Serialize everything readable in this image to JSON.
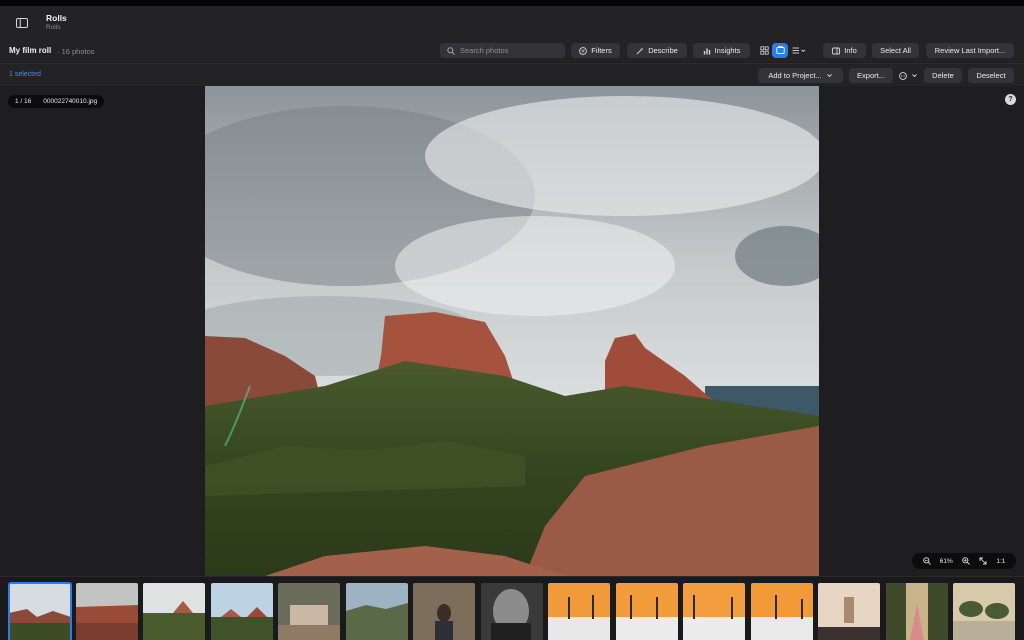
{
  "window": {
    "title": "Rolls",
    "subtitle": "Rolls"
  },
  "toolbar": {
    "roll_name": "My film roll",
    "photo_count": "· 16 photos",
    "search_placeholder": "Search photos",
    "filters_label": "Filters",
    "describe_label": "Describe",
    "insights_label": "Insights",
    "info_label": "Info",
    "select_all_label": "Select All",
    "review_label": "Review Last Import..."
  },
  "selection_bar": {
    "selected_text": "1 selected",
    "add_to_project_label": "Add to Project...",
    "export_label": "Export...",
    "delete_label": "Delete",
    "deselect_label": "Deselect"
  },
  "viewer": {
    "position": "1 / 16",
    "filename": "000022740010.jpg",
    "help": "?",
    "zoom_level": "61%",
    "actual_size": "1:1"
  },
  "filmstrip": {
    "count": 15,
    "selected_index": 0
  },
  "colors": {
    "accent": "#2b7de9",
    "selected_text": "#3e8ef7",
    "background": "#1e1e20",
    "button": "#343438"
  }
}
